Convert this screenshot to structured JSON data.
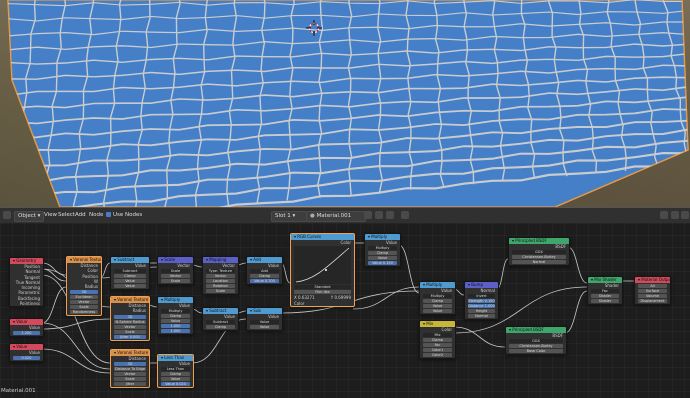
{
  "header": {
    "mode": "Object",
    "menus": [
      "View",
      "Select",
      "Add",
      "Node"
    ],
    "use_nodes_label": "Use Nodes",
    "slot": "Slot 1",
    "material": "Material.001"
  },
  "status": {
    "material": "Material.001"
  },
  "colors": {
    "input": "#d24a5b",
    "texture": "#d8914a",
    "vector": "#5b5fc7",
    "converter": "#4f9bd0",
    "color": "#c7b63a",
    "shader": "#3ea66a",
    "output": "#d24a5b",
    "plane": "#4d8bd6",
    "grout": "#e9e6de"
  },
  "nodes": {
    "geometry": {
      "title": "Geometry",
      "rows": [
        "Position",
        "Normal",
        "Tangent",
        "True Normal",
        "Incoming",
        "Parametric",
        "Backfacing",
        "Pointiness"
      ]
    },
    "value1": {
      "title": "Value",
      "rows": [
        "Value"
      ],
      "field": "1.200"
    },
    "value2": {
      "title": "Value",
      "rows": [
        "Value"
      ],
      "field": "0.020"
    },
    "voronoi1": {
      "title": "Voronoi Texture",
      "rows": [
        "Distance",
        "Color",
        "Position",
        "W",
        "Radius"
      ],
      "fields": [
        "3D",
        "Euclidean",
        "Vector",
        "Scale",
        "Randomness"
      ]
    },
    "subtract": {
      "title": "Subtract",
      "rows": [
        "Value"
      ],
      "fields": [
        "Subtract",
        "Clamp",
        "Value",
        "Value"
      ]
    },
    "voronoi2": {
      "title": "Voronoi Texture",
      "rows": [
        "Distance",
        "Radius"
      ],
      "fields": [
        "3D",
        "N-Sphere Radius",
        "Vector",
        "Scale",
        "Jitter 0.000"
      ]
    },
    "voronoi3": {
      "title": "Voronoi Texture",
      "rows": [
        "Distance"
      ],
      "fields": [
        "3D",
        "Distance To Edge",
        "Vector",
        "Scale",
        "Jitter"
      ]
    },
    "scale": {
      "title": "Scale",
      "rows": [
        "Vector"
      ],
      "fields": [
        "Scale",
        "Vector",
        "Scale"
      ]
    },
    "multiply1": {
      "title": "Multiply",
      "rows": [
        "Value"
      ],
      "fields": [
        "Multiply",
        "Clamp",
        "Value",
        "1.000",
        "1.000"
      ]
    },
    "mapping": {
      "title": "Mapping",
      "rows": [
        "Vector"
      ],
      "fields": [
        "Type: Texture",
        "Vector",
        "Location",
        "Rotation",
        "Scale"
      ]
    },
    "add1": {
      "title": "Add",
      "rows": [
        "Value"
      ],
      "fields": [
        "Add",
        "Clamp",
        "Value 0.700"
      ]
    },
    "subtract2": {
      "title": "Subtract",
      "rows": [
        "Value"
      ],
      "fields": [
        "Subtract",
        "Clamp"
      ]
    },
    "less": {
      "title": "Less Than",
      "rows": [
        "Value"
      ],
      "fields": [
        "Less Than",
        "Clamp",
        "Value",
        "Value 0.020"
      ]
    },
    "sub3": {
      "title": "Sub",
      "rows": [
        "Value"
      ],
      "fields": [
        "Value",
        "Value"
      ]
    },
    "rgbcurves": {
      "title": "RGB Curves",
      "rows": [
        "Color"
      ],
      "fields": [
        "Standard",
        "Film like"
      ],
      "footer": [
        "X 0.63271",
        "Y 0.69999"
      ],
      "input": "Color"
    },
    "multiply2": {
      "title": "Multiply",
      "rows": [
        "Value"
      ],
      "fields": [
        "Multiply",
        "Clamp",
        "Value",
        "Value 0.150"
      ]
    },
    "multiply3": {
      "title": "Multiply",
      "rows": [
        "Value"
      ],
      "fields": [
        "Multiply",
        "Clamp",
        "Value",
        "Value"
      ]
    },
    "mix": {
      "title": "Mix",
      "rows": [
        "Color"
      ],
      "fields": [
        "Mix",
        "Clamp",
        "Fac",
        "Color1",
        "Color2"
      ]
    },
    "bump": {
      "title": "Bump",
      "rows": [
        "Normal"
      ],
      "fields": [
        "Invert",
        "Strength 0.150",
        "Distance 1.000",
        "Height",
        "Normal"
      ]
    },
    "bsdf1": {
      "title": "Principled BSDF",
      "rows": [
        "BSDF"
      ],
      "fields": [
        "GGX",
        "Christensen-Burley",
        "Normal"
      ]
    },
    "bsdf2": {
      "title": "Principled BSDF",
      "rows": [
        "BSDF"
      ],
      "fields": [
        "GGX",
        "Christensen-Burley",
        "Base Color"
      ]
    },
    "mixshader": {
      "title": "Mix Shader",
      "rows": [
        "Shader"
      ],
      "fields": [
        "Fac",
        "Shader",
        "Shader"
      ]
    },
    "output": {
      "title": "Material Output",
      "rows": [],
      "fields": [
        "All",
        "Surface",
        "Volume",
        "Displacement"
      ]
    }
  }
}
